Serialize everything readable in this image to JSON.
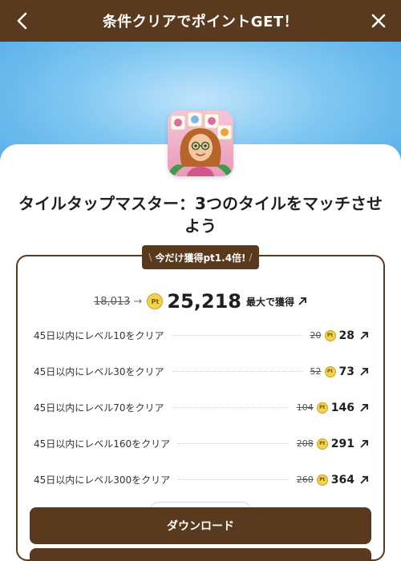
{
  "header": {
    "title": "条件クリアでポイントGET！"
  },
  "app": {
    "title": "タイルタップマスター：3つのタイルをマッチさせよう",
    "icon": "tile-match-game-icon"
  },
  "promo": {
    "label": "今だけ獲得pt1.4倍!"
  },
  "reward": {
    "old_total": "18,013",
    "new_total": "25,218",
    "max_label": "最大で獲得",
    "coin_label": "Pt"
  },
  "tasks": [
    {
      "label": "45日以内にレベル10をクリア",
      "old": "20",
      "new": "28"
    },
    {
      "label": "45日以内にレベル30をクリア",
      "old": "52",
      "new": "73"
    },
    {
      "label": "45日以内にレベル70をクリア",
      "old": "104",
      "new": "146"
    },
    {
      "label": "45日以内にレベル160をクリア",
      "old": "208",
      "new": "291"
    },
    {
      "label": "45日以内にレベル300をクリア",
      "old": "260",
      "new": "364"
    }
  ],
  "buttons": {
    "download": "ダウンロード"
  },
  "colors": {
    "brand_brown": "#5a3a1e",
    "sky_blue": "#4fa9e6",
    "coin_gold": "#f3d34a"
  }
}
